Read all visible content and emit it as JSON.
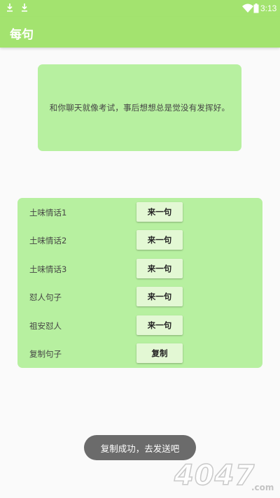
{
  "status_bar": {
    "time": "3:13",
    "icons": [
      "download-icon",
      "download-icon",
      "wifi-icon",
      "battery-icon"
    ]
  },
  "app_bar": {
    "title": "每句"
  },
  "quote": {
    "text": "和你聊天就像考试，事后想想总是觉没有发挥好。"
  },
  "actions": [
    {
      "label": "土味情话1",
      "button": "来一句"
    },
    {
      "label": "土味情话2",
      "button": "来一句"
    },
    {
      "label": "土味情话3",
      "button": "来一句"
    },
    {
      "label": "怼人句子",
      "button": "来一句"
    },
    {
      "label": "祖安怼人",
      "button": "来一句"
    },
    {
      "label": "复制句子",
      "button": "复制"
    }
  ],
  "toast": {
    "text": "复制成功，去发送吧"
  },
  "watermark": {
    "text": "4047",
    "suffix": ".com"
  },
  "colors": {
    "accent": "#a3e36f",
    "card": "#b7f0a0",
    "button": "#e3f8d4",
    "toast": "#6b6b6b"
  }
}
